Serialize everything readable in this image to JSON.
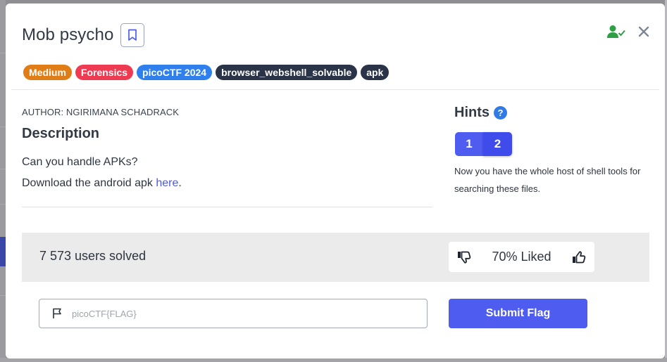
{
  "challenge": {
    "title": "Mob psycho",
    "tags": [
      {
        "label": "Medium",
        "color": "#e07d16"
      },
      {
        "label": "Forensics",
        "color": "#ef3b52"
      },
      {
        "label": "picoCTF 2024",
        "color": "#2f80ed"
      },
      {
        "label": "browser_webshell_solvable",
        "color": "#2a3348"
      },
      {
        "label": "apk",
        "color": "#2a3348"
      }
    ]
  },
  "header_icons": {
    "solved_icon": "user-check-icon",
    "solved_color": "#2ea043",
    "close_icon": "close-icon"
  },
  "description": {
    "author": "AUTHOR: NGIRIMANA SCHADRACK",
    "heading": "Description",
    "line1": "Can you handle APKs?",
    "line2_prefix": "Download the android apk ",
    "line2_link": "here",
    "line2_suffix": "."
  },
  "hints": {
    "heading": "Hints",
    "help_icon": "?",
    "buttons": [
      "1",
      "2"
    ],
    "active_hint_text": "Now you have the whole host of shell tools for searching these files."
  },
  "stats": {
    "solved_text": "7 573 users solved",
    "liked_text": "70% Liked"
  },
  "flag_form": {
    "placeholder": "picoCTF{FLAG}",
    "value": "",
    "submit_label": "Submit Flag"
  },
  "colors": {
    "accent": "#4f5cf0",
    "link": "#4b5ae0",
    "stats_bg": "#ebebeb"
  }
}
